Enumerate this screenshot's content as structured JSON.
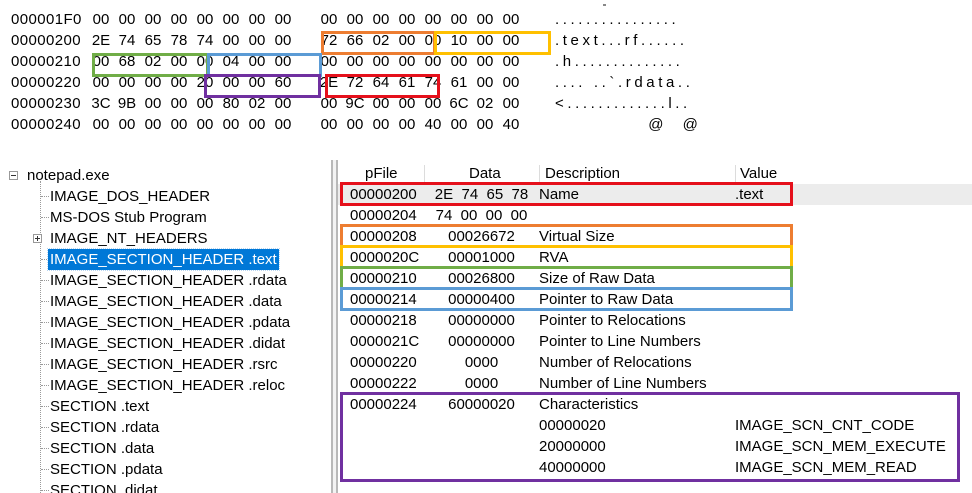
{
  "colors": {
    "red": "#e5101b",
    "orange": "#ed7d31",
    "yellow": "#ffc000",
    "green": "#70ad47",
    "blue": "#5b9bd5",
    "purple": "#7030a0",
    "selection": "#0078d7"
  },
  "hex": {
    "rows": [
      {
        "address": "000001F0",
        "bytes": [
          "00",
          "00",
          "00",
          "00",
          "00",
          "00",
          "00",
          "00",
          "00",
          "00",
          "00",
          "00",
          "00",
          "00",
          "00",
          "00"
        ],
        "ascii": "................"
      },
      {
        "address": "00000200",
        "bytes": [
          "2E",
          "74",
          "65",
          "78",
          "74",
          "00",
          "00",
          "00",
          "72",
          "66",
          "02",
          "00",
          "00",
          "10",
          "00",
          "00"
        ],
        "ascii": ".text...rf......"
      },
      {
        "address": "00000210",
        "bytes": [
          "00",
          "68",
          "02",
          "00",
          "00",
          "04",
          "00",
          "00",
          "00",
          "00",
          "00",
          "00",
          "00",
          "00",
          "00",
          "00"
        ],
        "ascii": ".h.............."
      },
      {
        "address": "00000220",
        "bytes": [
          "00",
          "00",
          "00",
          "00",
          "20",
          "00",
          "00",
          "60",
          "2E",
          "72",
          "64",
          "61",
          "74",
          "61",
          "00",
          "00"
        ],
        "ascii": ".... ..`.rdata.."
      },
      {
        "address": "00000230",
        "bytes": [
          "3C",
          "9B",
          "00",
          "00",
          "00",
          "80",
          "02",
          "00",
          "00",
          "9C",
          "00",
          "00",
          "00",
          "6C",
          "02",
          "00"
        ],
        "ascii": "<.............l.."
      },
      {
        "address": "00000240",
        "bytes": [
          "00",
          "00",
          "00",
          "00",
          "00",
          "00",
          "00",
          "00",
          "00",
          "00",
          "00",
          "00",
          "40",
          "00",
          "00",
          "40"
        ],
        "ascii": "            @  @"
      }
    ]
  },
  "tree": {
    "root": "notepad.exe",
    "items": [
      {
        "label": "IMAGE_DOS_HEADER"
      },
      {
        "label": "MS-DOS Stub Program"
      },
      {
        "label": "IMAGE_NT_HEADERS",
        "expander": "plus"
      },
      {
        "label": "IMAGE_SECTION_HEADER .text",
        "selected": true
      },
      {
        "label": "IMAGE_SECTION_HEADER .rdata"
      },
      {
        "label": "IMAGE_SECTION_HEADER .data"
      },
      {
        "label": "IMAGE_SECTION_HEADER .pdata"
      },
      {
        "label": "IMAGE_SECTION_HEADER .didat"
      },
      {
        "label": "IMAGE_SECTION_HEADER .rsrc"
      },
      {
        "label": "IMAGE_SECTION_HEADER .reloc"
      },
      {
        "label": "SECTION .text"
      },
      {
        "label": "SECTION .rdata"
      },
      {
        "label": "SECTION .data"
      },
      {
        "label": "SECTION .pdata"
      },
      {
        "label": "SECTION .didat"
      }
    ]
  },
  "table": {
    "columns": {
      "pfile": "pFile",
      "data": "Data",
      "description": "Description",
      "value": "Value"
    },
    "rows": [
      {
        "pfile": "00000200",
        "data": "2E  74  65  78",
        "description": "Name",
        "value": ".text"
      },
      {
        "pfile": "00000204",
        "data": "74  00  00  00",
        "description": "",
        "value": ""
      },
      {
        "pfile": "00000208",
        "data": "00026672",
        "description": "Virtual Size",
        "value": ""
      },
      {
        "pfile": "0000020C",
        "data": "00001000",
        "description": "RVA",
        "value": ""
      },
      {
        "pfile": "00000210",
        "data": "00026800",
        "description": "Size of Raw Data",
        "value": ""
      },
      {
        "pfile": "00000214",
        "data": "00000400",
        "description": "Pointer to Raw Data",
        "value": ""
      },
      {
        "pfile": "00000218",
        "data": "00000000",
        "description": "Pointer to Relocations",
        "value": ""
      },
      {
        "pfile": "0000021C",
        "data": "00000000",
        "description": "Pointer to Line Numbers",
        "value": ""
      },
      {
        "pfile": "00000220",
        "data": "0000",
        "description": "Number of Relocations",
        "value": ""
      },
      {
        "pfile": "00000222",
        "data": "0000",
        "description": "Number of Line Numbers",
        "value": ""
      },
      {
        "pfile": "00000224",
        "data": "60000020",
        "description": "Characteristics",
        "value": ""
      },
      {
        "pfile": "",
        "data": "",
        "description": "00000020",
        "value": "IMAGE_SCN_CNT_CODE"
      },
      {
        "pfile": "",
        "data": "",
        "description": "20000000",
        "value": "IMAGE_SCN_MEM_EXECUTE"
      },
      {
        "pfile": "",
        "data": "",
        "description": "40000000",
        "value": "IMAGE_SCN_MEM_READ"
      }
    ]
  }
}
